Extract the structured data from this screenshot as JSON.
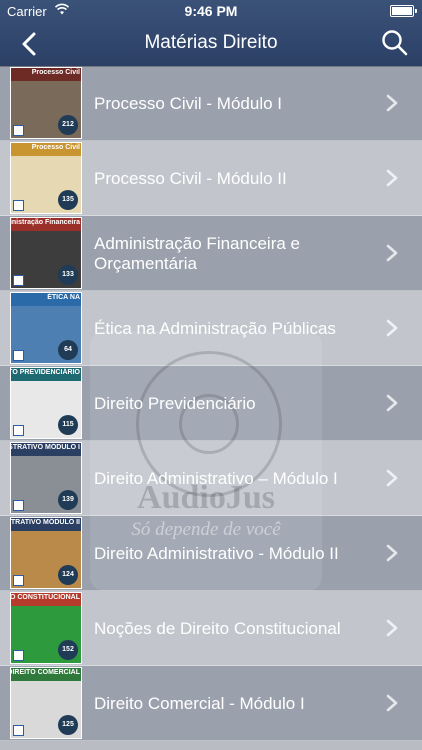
{
  "status_bar": {
    "carrier": "Carrier",
    "time": "9:46 PM"
  },
  "nav": {
    "title": "Matérias Direito",
    "back_icon": "chevron-left-icon",
    "search_icon": "search-icon"
  },
  "watermark": {
    "name": "AudioJus",
    "tagline": "Só depende de você"
  },
  "items": [
    {
      "label": "Processo Civil - Módulo I",
      "thumb_title": "Processo Civil",
      "badge": "212",
      "band_color": "#6e2a24",
      "art_color": "#7a6a5a"
    },
    {
      "label": "Processo Civil - Módulo II",
      "thumb_title": "Processo Civil",
      "badge": "135",
      "band_color": "#c99531",
      "art_color": "#e7d8b4"
    },
    {
      "label": "Administração Financeira e Orçamentária",
      "thumb_title": "Administração Financeira",
      "badge": "133",
      "band_color": "#9b2f2a",
      "art_color": "#3d3d3d"
    },
    {
      "label": "Ética na Administração Públicas",
      "thumb_title": "ÉTICA NA",
      "badge": "64",
      "band_color": "#2a6aa8",
      "art_color": "#4d7fb2"
    },
    {
      "label": "Direito Previdenciário",
      "thumb_title": "DIREITO PREVIDENCIÁRIO",
      "badge": "115",
      "band_color": "#1e6a73",
      "art_color": "#e8e8e8"
    },
    {
      "label": "Direito Administrativo – Módulo I",
      "thumb_title": "DIREITO ADMINISTRATIVO MÓDULO I",
      "badge": "139",
      "band_color": "#2b3f62",
      "art_color": "#8a8f95"
    },
    {
      "label": "Direito Administrativo - Módulo II",
      "thumb_title": "DIREITO ADMINISTRATIVO MÓDULO II",
      "badge": "124",
      "band_color": "#2b3f62",
      "art_color": "#b98a4a"
    },
    {
      "label": "Noções de Direito Constitucional",
      "thumb_title": "DIREITO CONSTITUCIONAL",
      "badge": "152",
      "band_color": "#b53b2c",
      "art_color": "#2e9a3e"
    },
    {
      "label": "Direito Comercial - Módulo I",
      "thumb_title": "DIREITO COMERCIAL",
      "badge": "125",
      "band_color": "#2f7a3a",
      "art_color": "#d9d9d9"
    }
  ],
  "colors": {
    "nav_bg": "#2f446b",
    "row_dark": "#9aa1ad",
    "row_light": "#c2c6cc",
    "text": "#ffffff"
  }
}
